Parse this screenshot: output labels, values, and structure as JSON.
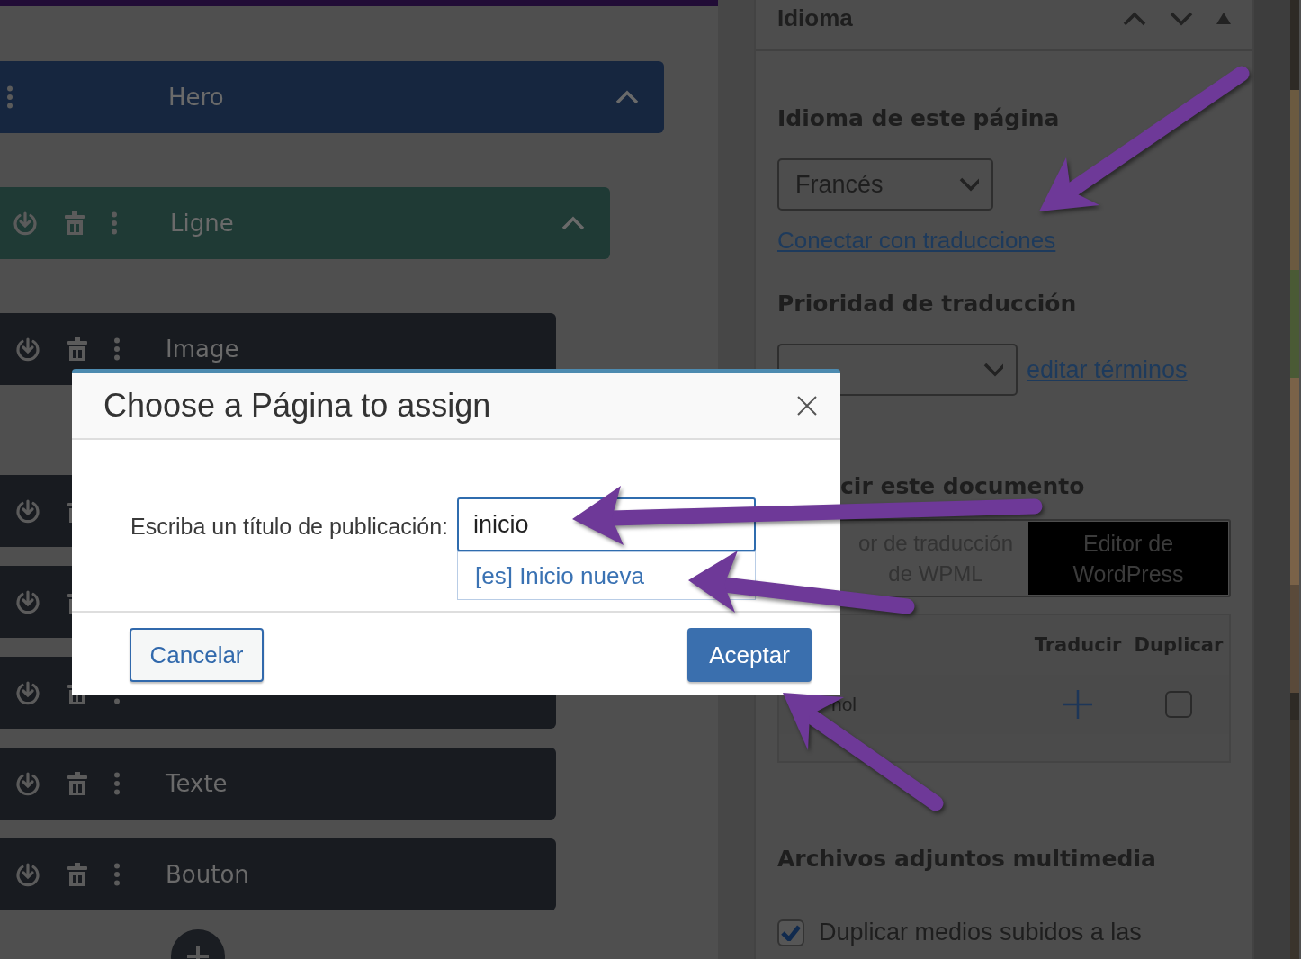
{
  "blocks": [
    {
      "kind": "section",
      "label": "Hero",
      "expanded": true
    },
    {
      "kind": "row",
      "label": "Ligne",
      "expanded": true
    },
    {
      "kind": "module",
      "label": "Image"
    },
    {
      "kind": "covered"
    },
    {
      "kind": "covered"
    },
    {
      "kind": "module"
    },
    {
      "kind": "module",
      "label": "Texte"
    },
    {
      "kind": "module",
      "label": "Bouton"
    }
  ],
  "panel": {
    "title": "Idioma",
    "language_label": "Idioma de este página",
    "language_select": {
      "value": "Francés"
    },
    "connect_link": "Conectar con traducciones",
    "priority_label": "Prioridad de traducción",
    "terms_link": "editar términos",
    "translate_heading": "cir este documento",
    "editor_toggle": [
      {
        "label": "or de traducción de WPML",
        "selected": false
      },
      {
        "label": "Editor de WordPress",
        "selected": true
      }
    ],
    "translations_table": {
      "columns": [
        "Traducir",
        "Duplicar"
      ],
      "rows": [
        {
          "language": "ñol",
          "duplicate": false
        }
      ]
    },
    "media_heading": "Archivos adjuntos multimedia",
    "media_option": {
      "label": "Duplicar medios subidos a las",
      "checked": true
    }
  },
  "modal": {
    "title": "Choose a Página to assign",
    "field_label": "Escriba un título de publicación:",
    "field_value": "inicio",
    "suggestions": [
      "[es] Inicio nueva"
    ],
    "buttons": [
      {
        "label": "Cancelar",
        "kind": "secondary"
      },
      {
        "label": "Aceptar",
        "kind": "primary"
      }
    ]
  }
}
